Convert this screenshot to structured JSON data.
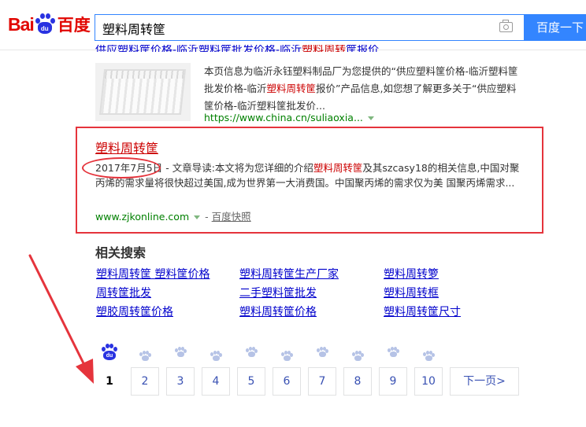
{
  "logo": {
    "latin": "Bai",
    "paw_text": "du",
    "chinese": "百度"
  },
  "search": {
    "query": "塑料周转筐",
    "button_label": "百度一下"
  },
  "prev_result": {
    "title_pre": "供应塑料筐价格-临沂塑料筐批发价格-临沂",
    "title_hl": "塑料周转",
    "title_post": "筐报价",
    "abstract_a": "本页信息为临沂永钰塑料制品厂为您提供的“供应塑料筐价格-临沂塑料筐批发价格-临沂",
    "abstract_hl": "塑料周转筐",
    "abstract_b": "报价”产品信息,如您想了解更多关于“供应塑料筐价格-临沂塑料筐批发价...",
    "url": "https://www.china.cn/suliaoxia..."
  },
  "main_result": {
    "title": "塑料周转筐",
    "date": "2017年7月5日",
    "sep": " - ",
    "abstract_a": "文章导读:本文将为您详细的介绍",
    "abstract_hl": "塑料周转筐",
    "abstract_b": "及其szcasy18的相关信息,中国对聚丙烯的需求量将很快超过美国,成为世界第一大消费国。中国聚丙烯的需求仅为美 国聚丙烯需求...",
    "url": "www.zjkonline.com",
    "url_sep": "-",
    "snapshot": "百度快照"
  },
  "related": {
    "title": "相关搜索",
    "items": [
      "塑料周转筐 塑料筐价格",
      "塑料周转筐生产厂家",
      "塑料周转箩",
      "周转筐批发",
      "二手塑料筐批发",
      "塑料周转框",
      "塑胶周转筐价格",
      "塑料周转筐价格",
      "塑料周转筐尺寸"
    ]
  },
  "pagination": {
    "paw_text": "du",
    "current": "1",
    "pages": [
      "2",
      "3",
      "4",
      "5",
      "6",
      "7",
      "8",
      "9",
      "10"
    ],
    "next_label": "下一页>"
  },
  "colors": {
    "accent": "#3385ff",
    "link": "#0000cc",
    "highlight": "#cc0000",
    "annotation": "#e5343c",
    "url": "#008000"
  }
}
